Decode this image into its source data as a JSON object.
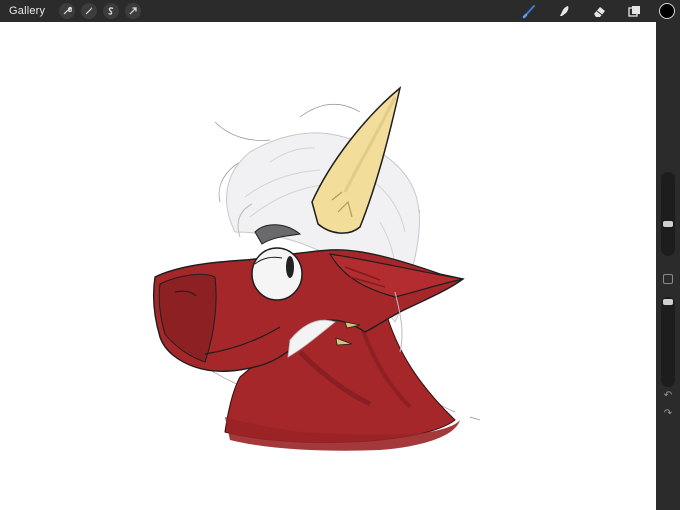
{
  "topbar": {
    "gallery_label": "Gallery",
    "left_tools": [
      {
        "name": "wrench-icon"
      },
      {
        "name": "magic-wand-icon"
      },
      {
        "name": "selection-icon"
      },
      {
        "name": "transform-arrow-icon"
      }
    ],
    "right_tools": [
      {
        "name": "brush-icon",
        "active": true
      },
      {
        "name": "smudge-icon"
      },
      {
        "name": "eraser-icon"
      },
      {
        "name": "layers-icon"
      }
    ],
    "current_color": "#000000",
    "accent_color": "#3a7fd5"
  },
  "sidebar": {
    "brush_size_level": 0.63,
    "opacity_level": 0.0,
    "undo_icon": "undo-icon",
    "redo_icon": "redo-icon"
  },
  "canvas": {
    "background": "#ffffff",
    "artwork_colors": {
      "body": "#a5272a",
      "body_dark": "#7e1c1f",
      "horn": "#f2dd9b",
      "hair": "#e7e7ea",
      "line": "#1e1e1e"
    }
  }
}
